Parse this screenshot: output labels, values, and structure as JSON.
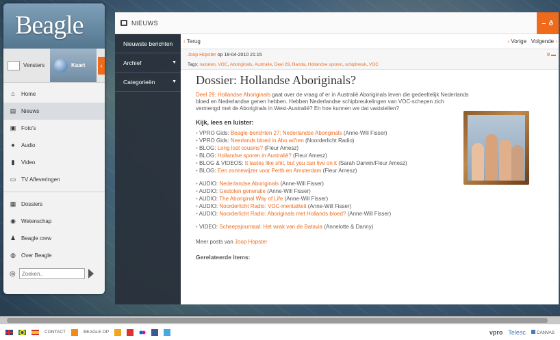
{
  "app": {
    "logo": "Beagle"
  },
  "left": {
    "vensters": "Vensters",
    "kaart": "Kaart",
    "nav": [
      {
        "label": "Home",
        "icon": "home-icon"
      },
      {
        "label": "Nieuws",
        "icon": "news-icon"
      },
      {
        "label": "Foto's",
        "icon": "photo-icon"
      },
      {
        "label": "Audio",
        "icon": "audio-icon"
      },
      {
        "label": "Video",
        "icon": "video-icon"
      },
      {
        "label": "TV Afleveringen",
        "icon": "tv-icon"
      }
    ],
    "nav2": [
      {
        "label": "Dossiers"
      },
      {
        "label": "Wetenschap"
      },
      {
        "label": "Beagle crew"
      },
      {
        "label": "Over Beagle"
      }
    ],
    "search_placeholder": "Zoeken.."
  },
  "window": {
    "title": "NIEUWS",
    "minimize": "–",
    "restore": "ð"
  },
  "categories": [
    "Nieuwste berichten",
    "Archief",
    "Categorieën"
  ],
  "navbar": {
    "back": "Terug",
    "prev": "Vorige",
    "next": "Volgende"
  },
  "meta": {
    "author": "Joop Hopster",
    "date_prefix": "op",
    "date": "18-04-2010 21:15",
    "comments": "0"
  },
  "tags": {
    "label": "Tags:",
    "items": [
      "nazaten",
      "VOC",
      "Aboriginals",
      "Australie",
      "Deel 29",
      "filanda",
      "Hollandse sporen",
      "schipbreuk",
      "VOC"
    ]
  },
  "post": {
    "title": "Dossier: Hollandse Aboriginals?",
    "intro_link": "Deel 29: Hollandse Aboriginals",
    "intro_text": " gaat over de vraag of er in Australië Aboriginals leven die gedeeltelijk Nederlands bloed en Nederlandse genen hebben. Hebben Nederlandse schipbreukelingen van VOC-schepen zich vermengd met de Aboriginals in West-Australië? En hoe kunnen we dat vaststellen?",
    "sub": "Kijk, lees en luister:",
    "list1": [
      {
        "pre": "VPRO Gids: ",
        "link": "Beagle-berichten 27: Nederlandse Aboriginals",
        "post": " (Anne-Will Fisser)"
      },
      {
        "pre": "VPRO Gids: ",
        "link": "Neerlands bloed in Abo ad'ren",
        "post": " (Noorderlicht Radio)"
      },
      {
        "pre": "BLOG: ",
        "link": "Long lost cousins?",
        "post": " (Fleur Amesz)"
      },
      {
        "pre": "BLOG: ",
        "link": "Hollandse sporen in Australië?",
        "post": " (Fleur Amesz)"
      },
      {
        "pre": "BLOG & VIDEOS: ",
        "link": "It tastes like shit, but you can live on it",
        "post": " (Sarah Darwin/Fleur Amesz)"
      },
      {
        "pre": "BLOG: ",
        "link": "Een zonnewijzer voor Perth en Amsterdam",
        "post": " (Fleur Amesz)"
      }
    ],
    "list2": [
      {
        "pre": "AUDIO: ",
        "link": "Nederlandse Aboriginals",
        "post": " (Anne-Will Fisser)"
      },
      {
        "pre": "AUDIO: ",
        "link": "Gestolen generatie",
        "post": " (Anne-Will Fisser)"
      },
      {
        "pre": "AUDIO: ",
        "link": "The Aboriginal Way of Life",
        "post": " (Anne-Will Fisser)"
      },
      {
        "pre": "AUDIO: ",
        "link": "Noorderlicht Radio: VOC-mentaliteit",
        "post": " (Anne-Will Fisser)"
      },
      {
        "pre": "AUDIO: ",
        "link": "Noorderlicht Radio: Aboriginals met Hollands bloed?",
        "post": " (Anne-Will Fisser)"
      }
    ],
    "list3": [
      {
        "pre": "VIDEO: ",
        "link": "Scheepsjournaal: Het wrak van de Batavia",
        "post": " (Annelotte & Danny)"
      }
    ],
    "more_pre": "Meer posts van ",
    "more_link": "Joop Hopster",
    "related": "Gerelateerde items:"
  },
  "bottom": {
    "contact": "CONTACT",
    "beagle_op": "BEAGLE OP",
    "vpro": "vpro",
    "telesc": "Telesc",
    "canvas": "CANVAS"
  }
}
